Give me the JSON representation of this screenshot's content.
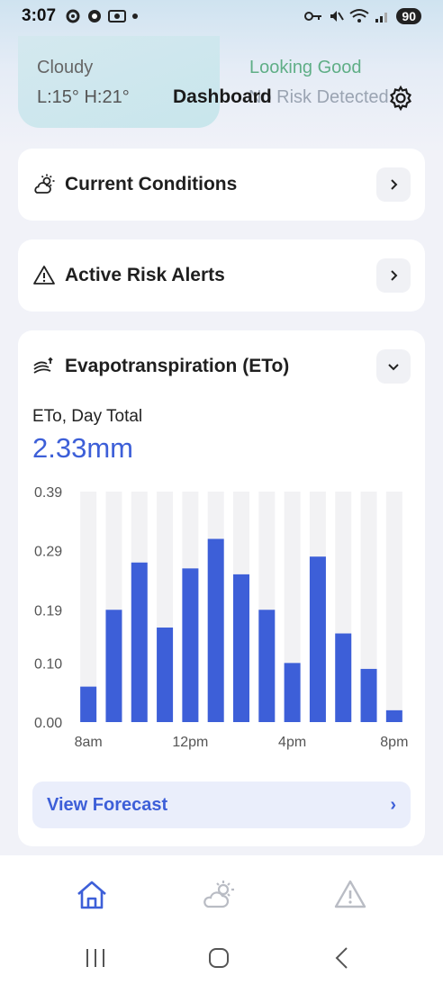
{
  "status_bar": {
    "time": "3:07",
    "battery": "90"
  },
  "header": {
    "weather_condition": "Cloudy",
    "temp_range": "L:15° H:21°",
    "status": "Looking Good",
    "risk_text": "No Risk Detected",
    "title": "Dashboard",
    "settings_icon": "gear-icon"
  },
  "cards": {
    "current_conditions": {
      "title": "Current Conditions",
      "icon": "sun-cloud-icon"
    },
    "active_risk_alerts": {
      "title": "Active Risk Alerts",
      "icon": "warning-icon"
    },
    "evapotranspiration": {
      "title": "Evapotranspiration (ETo)",
      "icon": "eto-icon"
    }
  },
  "eto": {
    "label": "ETo, Day Total",
    "value": "2.33mm"
  },
  "chart_data": {
    "type": "bar",
    "x": [
      "8am",
      "9am",
      "10am",
      "11am",
      "12pm",
      "1pm",
      "2pm",
      "3pm",
      "4pm",
      "5pm",
      "6pm",
      "7pm",
      "8pm"
    ],
    "values": [
      0.06,
      0.19,
      0.27,
      0.16,
      0.26,
      0.31,
      0.25,
      0.19,
      0.1,
      0.28,
      0.15,
      0.09,
      0.02
    ],
    "x_tick_labels": [
      "8am",
      "12pm",
      "4pm",
      "8pm"
    ],
    "y_ticks": [
      "0.39",
      "0.29",
      "0.19",
      "0.10",
      "0.00"
    ],
    "ylim": [
      0,
      0.39
    ],
    "bar_color": "#3d5fd8",
    "track_color": "#f2f2f4"
  },
  "forecast_button": {
    "label": "View Forecast",
    "arrow": "›"
  },
  "bottom_nav": {
    "items": [
      {
        "icon": "home-icon",
        "active": true
      },
      {
        "icon": "weather-icon",
        "active": false
      },
      {
        "icon": "alert-icon",
        "active": false
      }
    ]
  },
  "colors": {
    "accent": "#3d5fd8",
    "good": "#5fae86"
  }
}
